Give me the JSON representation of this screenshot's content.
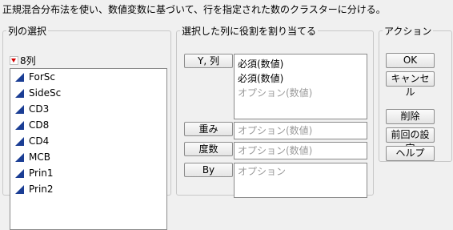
{
  "description": "正規混合分布法を使い、数値変数に基づいて、行を指定された数のクラスターに分ける。",
  "column_panel": {
    "title": "列の選択",
    "count_label": "8列",
    "columns": [
      "ForSc",
      "SideSc",
      "CD3",
      "CD8",
      "CD4",
      "MCB",
      "Prin1",
      "Prin2"
    ]
  },
  "role_panel": {
    "title": "選択した列に役割を割り当てる",
    "y_button": "Y, 列",
    "y_values": [
      "必須(数値)",
      "必須(数値)",
      "オプション(数値)"
    ],
    "weight_button": "重み",
    "weight_placeholder": "オプション(数値)",
    "freq_button": "度数",
    "freq_placeholder": "オプション(数値)",
    "by_button": "By",
    "by_placeholder": "オプション"
  },
  "action_panel": {
    "title": "アクション",
    "ok": "OK",
    "cancel": "キャンセル",
    "remove": "削除",
    "recall": "前回の設定",
    "help": "ヘルプ"
  },
  "colors": {
    "continuous_icon": "#1a3d94",
    "menu_triangle": "#d40000"
  },
  "icons": {
    "column_type": "continuous-triangle-icon",
    "menu": "red-triangle-menu-icon"
  }
}
